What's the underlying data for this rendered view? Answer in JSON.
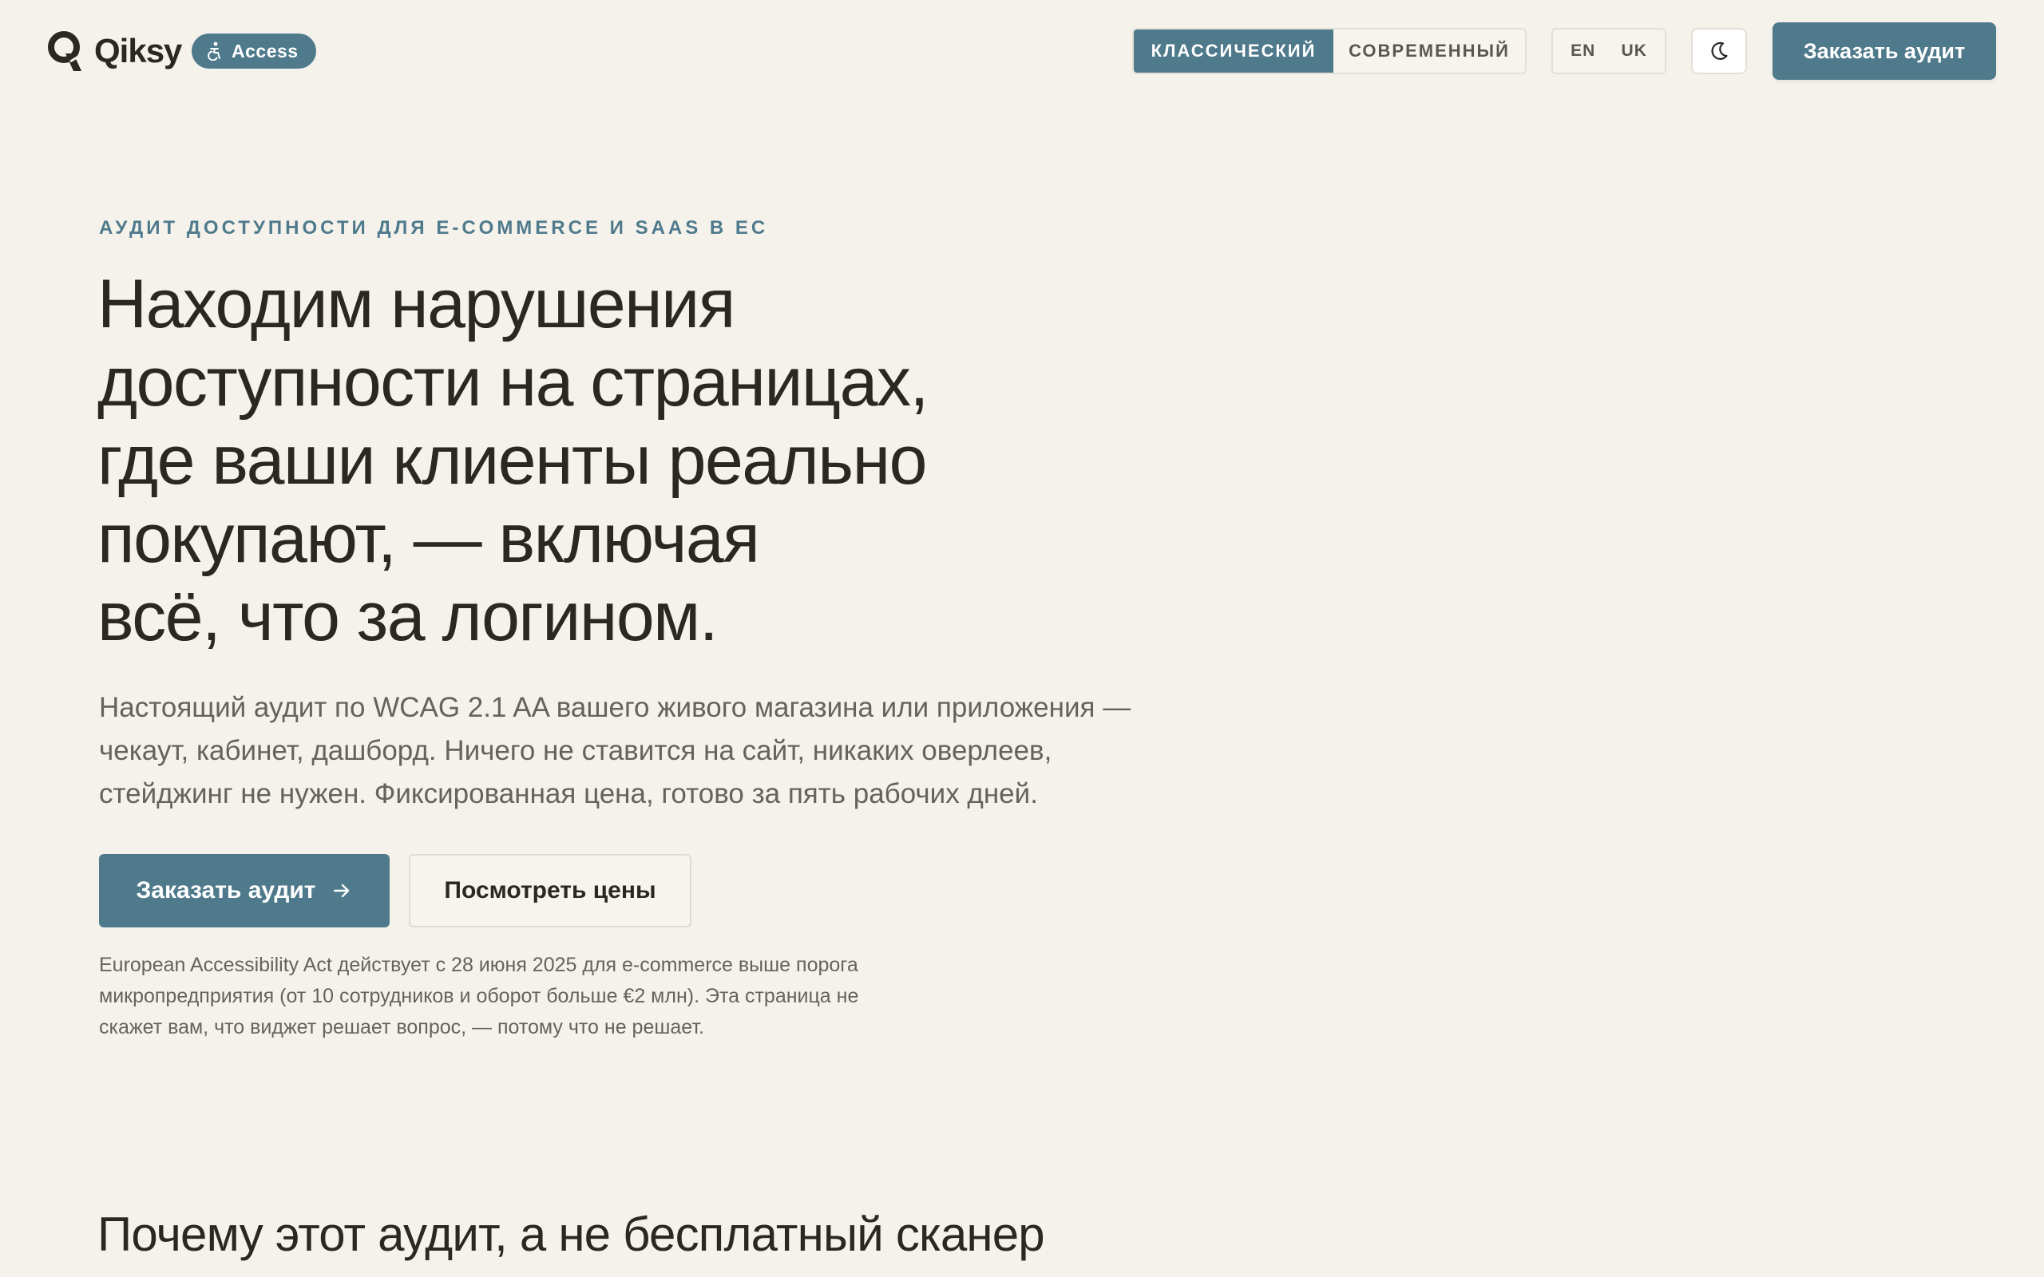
{
  "header": {
    "logo_text": "Qiksy",
    "access_badge": "Access",
    "style_toggle": {
      "classic": "КЛАССИЧЕСКИЙ",
      "modern": "СОВРЕМЕННЫЙ",
      "selected": "classic"
    },
    "languages": [
      "EN",
      "UK"
    ],
    "theme_icon": "moon-icon",
    "cta_label": "Заказать аудит"
  },
  "hero": {
    "eyebrow": "АУДИТ ДОСТУПНОСТИ ДЛЯ E-COMMERCE И SAAS В ЕС",
    "title_lines": [
      "Находим нарушения",
      "доступности на страницах,",
      "где ваши клиенты реально",
      "покупают, — включая",
      "всё, что за логином."
    ],
    "lead_lines": [
      "Настоящий аудит по WCAG 2.1 AA вашего живого магазина или приложения —",
      "чекаут, кабинет, дашборд. Ничего не ставится на сайт, никаких оверлеев,",
      "стейджинг не нужен. Фиксированная цена, готово за пять рабочих дней."
    ],
    "primary_button": "Заказать аудит",
    "secondary_button": "Посмотреть цены",
    "fineprint_lines": [
      "European Accessibility Act действует с 28 июня 2025 для e-commerce выше порога",
      "микропредприятия (от 10 сотрудников и оборот больше €2 млн). Эта страница не",
      "скажет вам, что виджет решает вопрос, — потому что не решает."
    ]
  },
  "next_section": {
    "heading": "Почему этот аудит, а не бесплатный сканер"
  },
  "colors": {
    "background": "#f5f2ec",
    "accent": "#4f7a8c",
    "text": "#2b2823",
    "muted": "#67625a"
  }
}
